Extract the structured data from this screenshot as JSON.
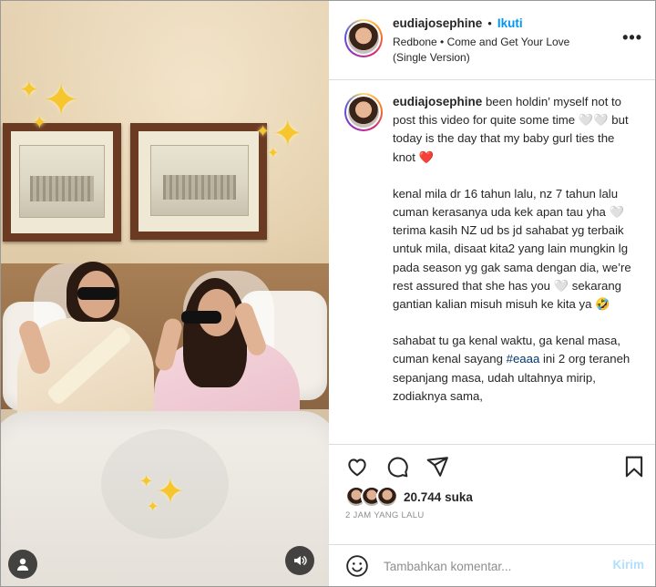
{
  "post": {
    "username": "eudiajosephine",
    "separator": "•",
    "follow_label": "Ikuti",
    "music": "Redbone • Come and Get Your Love (Single Version)",
    "more_label": "•••"
  },
  "caption": {
    "username": "eudiajosephine",
    "paragraphs": [
      {
        "text": "been holdin’ myself not to post this video for quite some time 🤍🤍 but today is the day that my baby gurl ties the knot ❤️"
      },
      {
        "text": "kenal mila dr 16 tahun lalu, nz 7 tahun lalu cuman kerasanya uda kek apan tau yha 🤍 terima kasih NZ ud bs jd sahabat yg terbaik untuk mila, disaat kita2 yang lain mungkin lg pada season yg gak sama dengan dia, we’re rest assured that she has you 🤍 sekarang gantian kalian misuh misuh ke kita ya 🤣"
      },
      {
        "before": "sahabat tu ga kenal waktu, ga kenal masa, cuman kenal sayang ",
        "hashtag": "#eaaa",
        "after": " ini 2 org teraneh sepanjang masa, udah ultahnya mirip, zodiaknya sama,"
      }
    ]
  },
  "actions": {
    "likes_count": "20.744",
    "likes_unit": "suka",
    "timestamp": "2 JAM YANG LALU"
  },
  "comment": {
    "placeholder": "Tambahkan komentar...",
    "send_label": "Kirim"
  },
  "colors": {
    "accent": "#0095f6",
    "hashtag": "#00376b",
    "send_disabled": "#b2dffc",
    "border": "#dbdbdb",
    "muted": "#8e8e8e"
  },
  "icons": [
    "user-tag-icon",
    "volume-icon",
    "heart-icon",
    "comment-icon",
    "share-icon",
    "bookmark-icon",
    "emoji-icon",
    "sparkle-icon"
  ]
}
